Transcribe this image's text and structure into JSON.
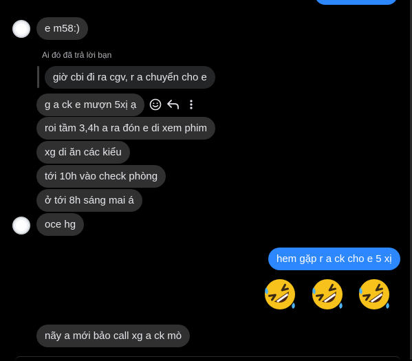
{
  "messages": {
    "m1": "e m58:)",
    "reply_label": "Ai đó đã trả lời bạn",
    "quoted": "giờ cbi đi ra cgv, r a chuyển cho e",
    "m2": "g a ck e mượn 5xị ạ",
    "m3": "roi tầm 3,4h a ra đón e di xem phim",
    "m4": "xg di ăn các kiểu",
    "m5": "tới 10h vào check phòng",
    "m6": "ở tới 8h sáng mai á",
    "m7": "oce hg",
    "mine1": "hem gặp r a ck cho e 5 xị",
    "m8": "nãy a mới bảo call xg a ck mò"
  },
  "icons": {
    "react": "smiley-icon",
    "reply": "reply-arrow-icon",
    "more": "more-vertical-icon",
    "emoji": "rolling-laughing-emoji"
  },
  "colors": {
    "background": "#000000",
    "incoming_bubble": "#303030",
    "outgoing_bubble": "#2d88ff",
    "text": "#e4e6eb",
    "muted": "#b0b3b8"
  }
}
